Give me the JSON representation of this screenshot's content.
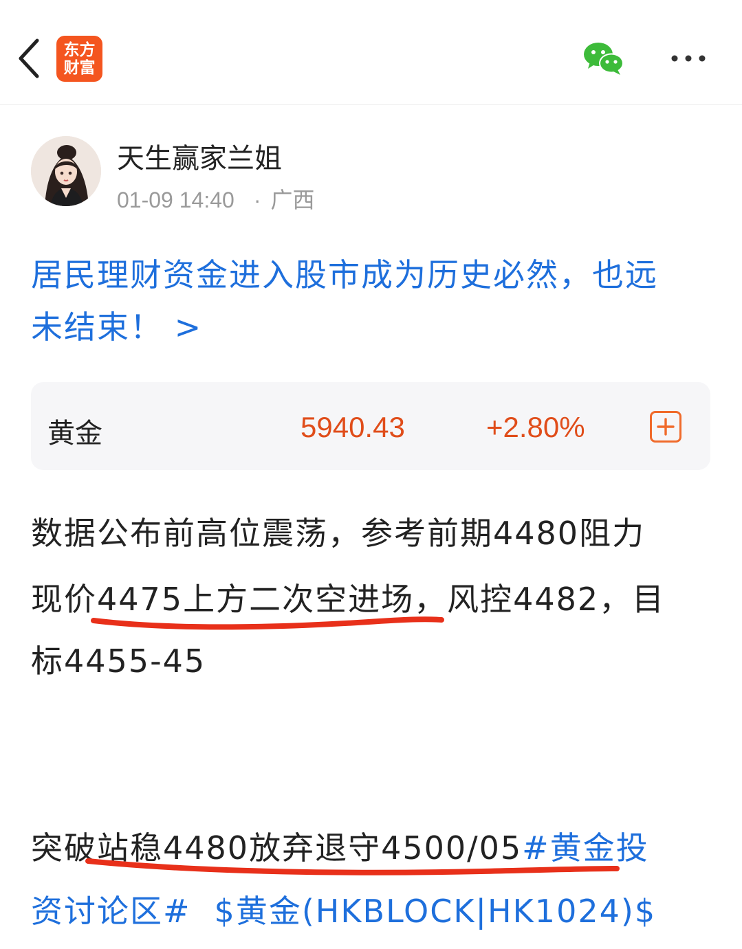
{
  "app": {
    "logo_line1": "东方",
    "logo_line2": "财富",
    "back_icon": "chevron-left-icon",
    "share_icon": "wechat-icon",
    "more_icon": "more-dots-icon",
    "brand_color": "#f4551f"
  },
  "post": {
    "author": "天生赢家兰姐",
    "time": "01-09 14:40",
    "separator": "·",
    "location": "广西",
    "headline_line1": "居民理财资金进入股市成为历史必然，也远",
    "headline_line2": "未结束！ >",
    "body_p1_line1": "数据公布前高位震荡，参考前期4480阻力",
    "body_p1_line2_a": "现价4475上方二次空进场",
    "body_p1_line2_b": "，风控4482，目",
    "body_p1_line3": "标4455-45",
    "body_p2_line1_a": "突破站稳4480放弃退守4500/05",
    "body_p2_line1_tag": "#黄金投",
    "body_p2_line2_tag": "资讨论区#",
    "body_p2_line2_stock": "$黄金(HKBLOCK|HK1024)$",
    "link_color": "#1e6fdc",
    "annotation_color": "#e8301a"
  },
  "stock_card": {
    "name": "黄金",
    "price": "5940.43",
    "change": "+2.80%",
    "add_icon": "plus-square-icon",
    "up_color": "#e04d1a"
  }
}
